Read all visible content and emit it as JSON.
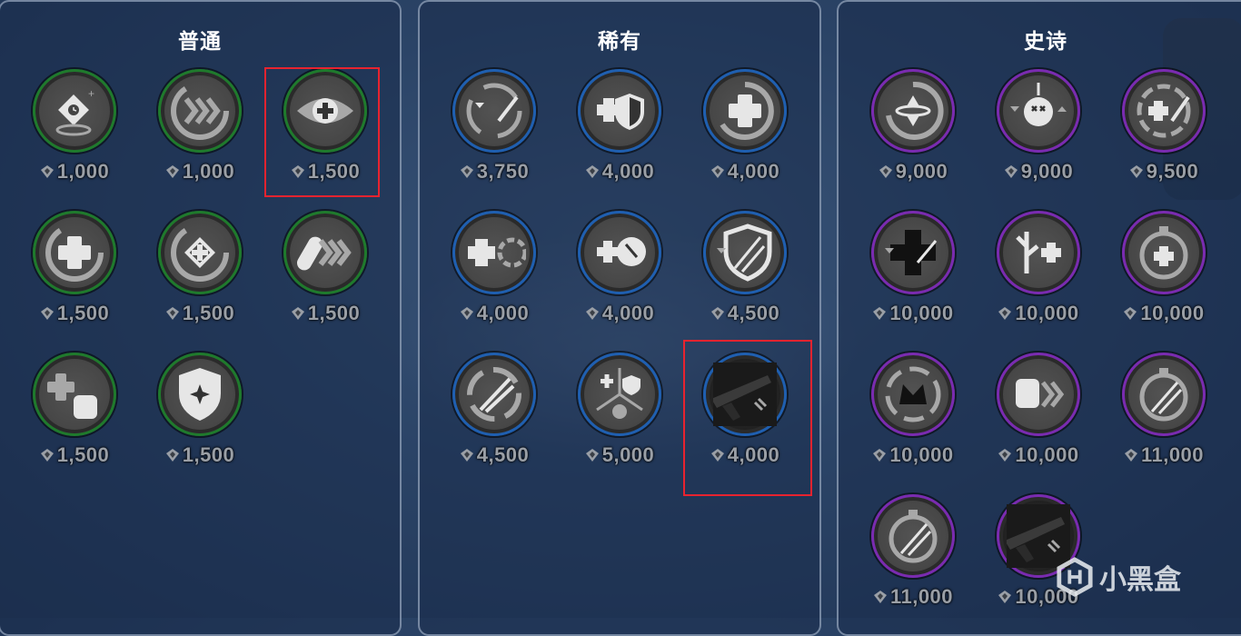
{
  "panels": [
    {
      "title": "普通",
      "ring_color": "#1f7a2c",
      "items": [
        {
          "icon": "clock-diamond-icon",
          "price": "1,000"
        },
        {
          "icon": "speed-chevrons-icon",
          "price": "1,000"
        },
        {
          "icon": "eye-heal-icon",
          "price": "1,500",
          "highlighted": true
        },
        {
          "icon": "heal-regen-icon",
          "price": "1,500"
        },
        {
          "icon": "heal-target-icon",
          "price": "1,500"
        },
        {
          "icon": "skateboard-speed-icon",
          "price": "1,500"
        },
        {
          "icon": "heal-fist-icon",
          "price": "1,500"
        },
        {
          "icon": "shield-sparkle-icon",
          "price": "1,500"
        }
      ]
    },
    {
      "title": "稀有",
      "ring_color": "#1f5fb0",
      "items": [
        {
          "icon": "bullet-stack-icon",
          "price": "3,750"
        },
        {
          "icon": "heal-shield-icon",
          "price": "4,000"
        },
        {
          "icon": "heal-recharge-icon",
          "price": "4,000"
        },
        {
          "icon": "heal-arrow-ammo-icon",
          "price": "4,000"
        },
        {
          "icon": "heal-head-icon",
          "price": "4,000"
        },
        {
          "icon": "broken-shield-icon",
          "price": "4,500"
        },
        {
          "icon": "slash-circle-icon",
          "price": "4,500"
        },
        {
          "icon": "heal-shield-ammo-icon",
          "price": "5,000"
        },
        {
          "icon": "weapon-image-icon",
          "price": "4,000",
          "highlighted": true
        }
      ]
    },
    {
      "title": "史诗",
      "ring_color": "#7a2bb0",
      "items": [
        {
          "icon": "reload-cycle-icon",
          "price": "9,000"
        },
        {
          "icon": "skull-buff-icon",
          "price": "9,000"
        },
        {
          "icon": "heal-ammo-slash-icon",
          "price": "9,500"
        },
        {
          "icon": "heal-cross-black-icon",
          "price": "10,000"
        },
        {
          "icon": "tree-heal-icon",
          "price": "10,000"
        },
        {
          "icon": "timer-heal-icon",
          "price": "10,000"
        },
        {
          "icon": "burst-crown-icon",
          "price": "10,000"
        },
        {
          "icon": "fist-speed-icon",
          "price": "10,000"
        },
        {
          "icon": "timer-slash-icon",
          "price": "11,000"
        },
        {
          "icon": "timer-slash-alt-icon",
          "price": "11,000"
        },
        {
          "icon": "weapon-image-icon",
          "price": "10,000"
        }
      ]
    }
  ],
  "watermark": {
    "text": "小黑盒",
    "icon": "xiaoheihe-logo-icon"
  }
}
